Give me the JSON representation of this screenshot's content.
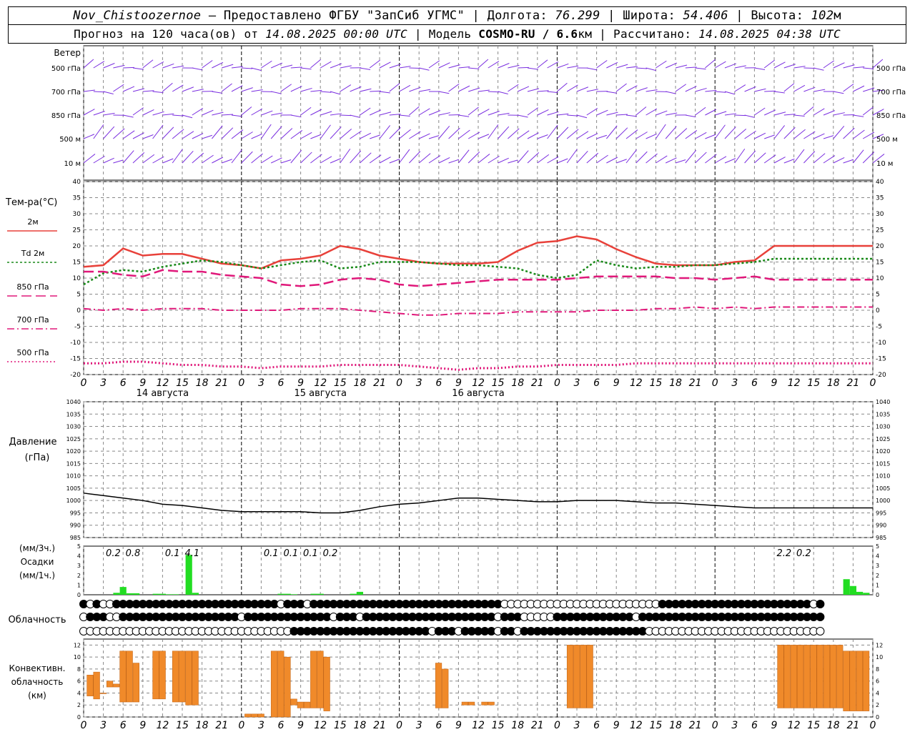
{
  "header": {
    "station": "Nov_Chistoozernoe",
    "provider": " – Предоставлено ФГБУ \"ЗапСиб УГМС\" | Долгота: ",
    "lon": "76.299",
    "lat_label": " | Широта: ",
    "lat": "54.406",
    "alt_label": " | Высота: ",
    "alt": "102",
    "alt_unit": "м",
    "forecast_prefix": "Прогноз на 120 часа(ов) от ",
    "forecast_from": "14.08.2025 00:00 UTC",
    "model_label": " | Модель ",
    "model": "COSMO-RU / 6.6",
    "model_unit": "км",
    "calc_label": " | Рассчитано: ",
    "calc_time": "14.08.2025 04:38 UTC"
  },
  "labels": {
    "wind": "Ветер",
    "wind_levels": [
      "500 гПа",
      "700 гПа",
      "850 гПа",
      "500 м",
      "10 м"
    ],
    "temp_title": "Тем-ра(°C)",
    "temp_series": [
      "2м",
      "Td 2м",
      "850 гПа",
      "700 гПа",
      "500 гПа"
    ],
    "pressure_title": "Давление",
    "pressure_unit": "(гПа)",
    "precip_unit_top": "(мм/3ч.)",
    "precip_title": "Осадки",
    "precip_unit_bottom": "(мм/1ч.)",
    "cloud_title": "Облачность",
    "conv_title": [
      "Конвективн.",
      "облачность",
      "(км)"
    ]
  },
  "colors": {
    "t2m": "#e8413a",
    "td2m": "#1a8a1a",
    "magenta": "#e0187a",
    "wind": "#7a2ee0",
    "pressure": "#000000",
    "precip": "#22dd22",
    "conv": "#f08a2a",
    "grid": "#888888"
  },
  "chart_data": [
    {
      "type": "line",
      "title": "Тем-ра(°C)",
      "x_hours_utc": [
        0,
        3,
        6,
        9,
        12,
        15,
        18,
        21,
        24,
        27,
        30,
        33,
        36,
        39,
        42,
        45,
        48,
        51,
        54,
        57,
        60,
        63,
        66,
        69,
        72,
        75,
        78,
        81,
        84,
        87,
        90,
        93,
        96,
        99,
        102,
        105,
        108,
        111,
        114,
        117,
        120
      ],
      "x_tick_labels": [
        "0",
        "3",
        "6",
        "9",
        "12",
        "15",
        "18",
        "21"
      ],
      "day_labels": [
        "14 августа",
        "15 августа",
        "16 августа"
      ],
      "ylim": [
        -20,
        40
      ],
      "yticks": [
        -20,
        -15,
        -10,
        -5,
        0,
        5,
        10,
        15,
        20,
        25,
        30,
        35,
        40
      ],
      "series": [
        {
          "name": "2м",
          "values": [
            13.5,
            14,
            19.2,
            17,
            17.5,
            17.5,
            16,
            14.5,
            14,
            13,
            15.5,
            16,
            17,
            20,
            19,
            17,
            16,
            15,
            14.5,
            14.5,
            14.5,
            15,
            18.5,
            21,
            21.5,
            23,
            22,
            19,
            16.5,
            14.5,
            14,
            14,
            14,
            15,
            15.5,
            20,
            20,
            20,
            20,
            20,
            20
          ]
        },
        {
          "name": "Td 2м",
          "values": [
            8,
            11.5,
            12.5,
            12,
            13.5,
            14.5,
            15.5,
            15,
            14,
            13,
            14,
            15,
            15.5,
            13,
            13.5,
            15,
            15,
            15,
            14.5,
            14,
            14,
            13.5,
            13,
            11,
            10,
            11,
            15.5,
            14,
            13,
            13.5,
            13.5,
            14,
            14,
            14.5,
            15,
            16,
            16,
            16,
            16,
            16,
            16
          ]
        },
        {
          "name": "850 гПа",
          "values": [
            12,
            12,
            11,
            10.5,
            12.5,
            12,
            12,
            11,
            10.5,
            10,
            8,
            7.5,
            8,
            9.5,
            10,
            9.5,
            8,
            7.5,
            8,
            8.5,
            9,
            9.5,
            9.5,
            9.5,
            9.5,
            10,
            10.5,
            10.5,
            10.5,
            10.5,
            10,
            10,
            9.5,
            10,
            10.5,
            9.5,
            9.5,
            9.5,
            9.5,
            9.5,
            9.5
          ]
        },
        {
          "name": "700 гПа",
          "values": [
            0.5,
            0,
            0.5,
            0,
            0.5,
            0.5,
            0.5,
            0,
            0,
            0,
            0,
            0.5,
            0.5,
            0.5,
            0,
            -0.5,
            -1,
            -1.5,
            -1.5,
            -1,
            -1,
            -1,
            -0.5,
            -0.5,
            -0.5,
            -0.5,
            0,
            0,
            0,
            0.5,
            0.5,
            1,
            0.5,
            1,
            0.5,
            1,
            1,
            1,
            1,
            1,
            1
          ]
        },
        {
          "name": "500 гПа",
          "values": [
            -16.5,
            -16.5,
            -16,
            -16,
            -16.5,
            -17,
            -17,
            -17.5,
            -17.5,
            -18,
            -17.5,
            -17.5,
            -17.5,
            -17,
            -17,
            -17,
            -17,
            -17.5,
            -18,
            -18.5,
            -18,
            -18,
            -17.5,
            -17.5,
            -17,
            -17,
            -17,
            -17,
            -16.5,
            -16.5,
            -16.5,
            -16.5,
            -16.5,
            -16.5,
            -16.5,
            -16.5,
            -16.5,
            -16.5,
            -16.5,
            -16.5,
            -16.5
          ]
        }
      ]
    },
    {
      "type": "line",
      "title": "Давление",
      "ylabel": "(гПа)",
      "ylim": [
        985,
        1040
      ],
      "yticks": [
        985,
        990,
        995,
        1000,
        1005,
        1010,
        1015,
        1020,
        1025,
        1030,
        1035,
        1040
      ],
      "x_hours_utc": [
        0,
        3,
        6,
        9,
        12,
        15,
        18,
        21,
        24,
        27,
        30,
        33,
        36,
        39,
        42,
        45,
        48,
        51,
        54,
        57,
        60,
        63,
        66,
        69,
        72,
        75,
        78,
        81,
        84,
        87,
        90,
        93,
        96,
        99,
        102,
        105,
        108,
        111,
        114,
        117,
        120
      ],
      "series": [
        {
          "name": "Давление",
          "values": [
            1003,
            1002,
            1001,
            1000,
            998.5,
            998,
            997,
            996,
            995.5,
            995.5,
            995.5,
            995.5,
            995,
            995,
            996,
            997.5,
            998.5,
            999,
            1000,
            1001,
            1001,
            1000.5,
            1000,
            999.5,
            999.5,
            1000,
            1000,
            1000,
            999.5,
            999,
            999,
            998.5,
            998,
            997.5,
            997,
            997,
            997,
            997,
            997,
            997,
            997
          ]
        }
      ]
    },
    {
      "type": "bar",
      "title": "Осадки",
      "ylim": [
        0,
        5
      ],
      "yticks": [
        0,
        0.5,
        1,
        1.5,
        2,
        2.5,
        3,
        3.5,
        4,
        4.5,
        5
      ],
      "x_hours_utc": [
        5,
        6,
        7,
        8,
        11,
        12,
        13,
        14,
        16,
        17,
        30,
        31,
        32,
        35,
        36,
        41,
        42,
        66,
        67,
        68,
        71,
        72,
        74,
        75,
        76,
        77,
        78,
        79,
        80,
        96,
        97,
        98,
        99,
        100,
        101,
        102,
        103,
        104,
        105,
        106,
        107,
        108,
        109,
        110,
        111,
        112,
        113,
        114,
        115,
        116,
        117,
        118,
        119
      ],
      "values": [
        0.2,
        0.8,
        0.15,
        0.15,
        0.1,
        0.1,
        0.05,
        0.05,
        4.1,
        0.2,
        0.1,
        0.1,
        0.05,
        0.1,
        0.1,
        0.1,
        0.3,
        0,
        0,
        0,
        0,
        0,
        0,
        0,
        0,
        0,
        0,
        0,
        0,
        0,
        0,
        0,
        0,
        0,
        0,
        0,
        0,
        0,
        0,
        0,
        0,
        0,
        0,
        0,
        0,
        0,
        0,
        0,
        0,
        1.6,
        0.9,
        0.3,
        0.2
      ],
      "labels": [
        {
          "x": 4.5,
          "text": "0.2"
        },
        {
          "x": 7.5,
          "text": "0.8"
        },
        {
          "x": 13.5,
          "text": "0.1"
        },
        {
          "x": 16.5,
          "text": "4.1"
        },
        {
          "x": 28.5,
          "text": "0.1"
        },
        {
          "x": 31.5,
          "text": "0.1"
        },
        {
          "x": 34.5,
          "text": "0.1"
        },
        {
          "x": 37.5,
          "text": "0.2"
        },
        {
          "x": 106.5,
          "text": "2.2"
        },
        {
          "x": 109.5,
          "text": "0.2"
        }
      ]
    },
    {
      "type": "heatmap",
      "title": "Облачность",
      "rows": 3,
      "x_hours_utc_step": 1,
      "cover_levels_0_to_1": [
        "10100111111111111111111111111101110111111111111111111111111111110000000000000000000000001111111111111111111111101",
        "01110011111111111111111101111111111111011101111111111111111111101110000011111111111101111111111111111111111111111",
        "00000000000000000000000000000000111111111111111111111011101111101101111111111111111111000000000000000000000000000"
      ]
    },
    {
      "type": "bar",
      "title": "Конвективн. облачность (км)",
      "ylim": [
        0,
        13
      ],
      "yticks": [
        0,
        2,
        4,
        6,
        8,
        10,
        12
      ],
      "x_hours_utc": [
        1,
        2,
        3,
        4,
        5,
        6,
        7,
        8,
        11,
        12,
        14,
        15,
        16,
        17,
        25,
        26,
        27,
        29,
        30,
        31,
        32,
        33,
        34,
        35,
        36,
        37,
        54,
        55,
        58,
        59,
        61,
        62,
        74,
        75,
        76,
        77,
        106,
        107,
        108,
        109,
        110,
        111,
        112,
        113,
        114,
        115,
        116,
        117,
        118,
        119
      ],
      "base_km": [
        3.5,
        3,
        4,
        5,
        5,
        2.5,
        2.5,
        2.5,
        3,
        3,
        2.5,
        2.5,
        2,
        2,
        0,
        0,
        0,
        0,
        0,
        0,
        2,
        1.5,
        1.5,
        1.5,
        1.5,
        1,
        1.5,
        1.5,
        2,
        2,
        2,
        2,
        1.5,
        1.5,
        1.5,
        1.5,
        1.5,
        1.5,
        1.5,
        1.5,
        1.5,
        1.5,
        1.5,
        1.5,
        1.5,
        1.5,
        1,
        1,
        1,
        1
      ],
      "top_km": [
        7,
        7.5,
        4,
        6,
        5.5,
        11,
        11,
        9,
        11,
        11,
        11,
        11,
        11,
        11,
        0.5,
        0.5,
        0.5,
        11,
        11,
        10,
        3,
        2.5,
        2.5,
        11,
        11,
        10,
        9,
        8,
        2.5,
        2.5,
        2.5,
        2.5,
        12,
        12,
        12,
        12,
        12,
        12,
        12,
        12,
        12,
        12,
        12,
        12,
        12,
        12,
        11,
        11,
        11,
        11
      ]
    }
  ]
}
